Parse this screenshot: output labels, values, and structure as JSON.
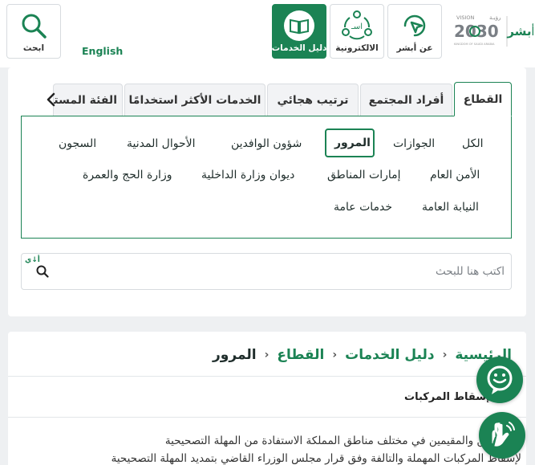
{
  "header": {
    "search_label": "ابحث",
    "language_label": "English",
    "guide_label": "دليل الخدمات",
    "eservices_label": "الالكترونية",
    "eservices_icon_text": "اسـ",
    "about_label": "عن أبشر",
    "logo": {
      "vision_text": "VISION",
      "year_text": "2030",
      "arabic_text": "رؤيـة",
      "kingdom_text": "KINGDOM OF SAUDI ARABIA",
      "absher_text": "أبشر"
    }
  },
  "tabs": [
    {
      "label": "القطاع",
      "active": true
    },
    {
      "label": "أفراد المجتمع",
      "active": false
    },
    {
      "label": "ترتيب هجائي",
      "active": false
    },
    {
      "label": "الخدمات الأكثر استخدامًا",
      "active": false
    },
    {
      "label": "الفئة المستهدفة",
      "active": false
    }
  ],
  "sectors": [
    {
      "label": "الكل",
      "selected": false
    },
    {
      "label": "الجوازات",
      "selected": false
    },
    {
      "label": "المرور",
      "selected": true
    },
    {
      "label": "شؤون الوافدين",
      "selected": false
    },
    {
      "label": "الأحوال المدنية",
      "selected": false
    },
    {
      "label": "السجون",
      "selected": false
    },
    {
      "label": "الأمن العام",
      "selected": false
    },
    {
      "label": "إمارات المناطق",
      "selected": false
    },
    {
      "label": "ديوان وزارة الداخلية",
      "selected": false
    },
    {
      "label": "وزارة الحج والعمرة",
      "selected": false
    },
    {
      "label": "النيابة العامة",
      "selected": false
    },
    {
      "label": "خدمات عامة",
      "selected": false
    }
  ],
  "search": {
    "placeholder": "اكتب هنا للبحث",
    "value": "",
    "keyboard_hint": "أ↓ي"
  },
  "breadcrumb": {
    "home": "الرئيسية",
    "guide": "دليل الخدمات",
    "sector": "القطاع",
    "current": "المرور",
    "separator": "›"
  },
  "service": {
    "title": "إسقاط المركبات",
    "description_line1": "المواطنين والمقيمين في مختلف مناطق المملكة الاستفادة من المهلة التصحيحية",
    "description_line2": "لإسقاط المركبات المهملة والتالفة وفق قرار مجلس الوزراء القاضي بتمديد المهلة التصحيحية"
  },
  "colors": {
    "brand_green": "#1b8354",
    "page_bg": "#eef0f2",
    "tab_bg": "#f2f3f5"
  },
  "icons": {
    "search": "search-icon",
    "guide": "book-icon",
    "eservices": "network-icon",
    "about": "cursor-icon",
    "chat": "chat-bot-icon",
    "sign": "sign-language-icon",
    "tabs_more": "chevron-left-icon"
  }
}
